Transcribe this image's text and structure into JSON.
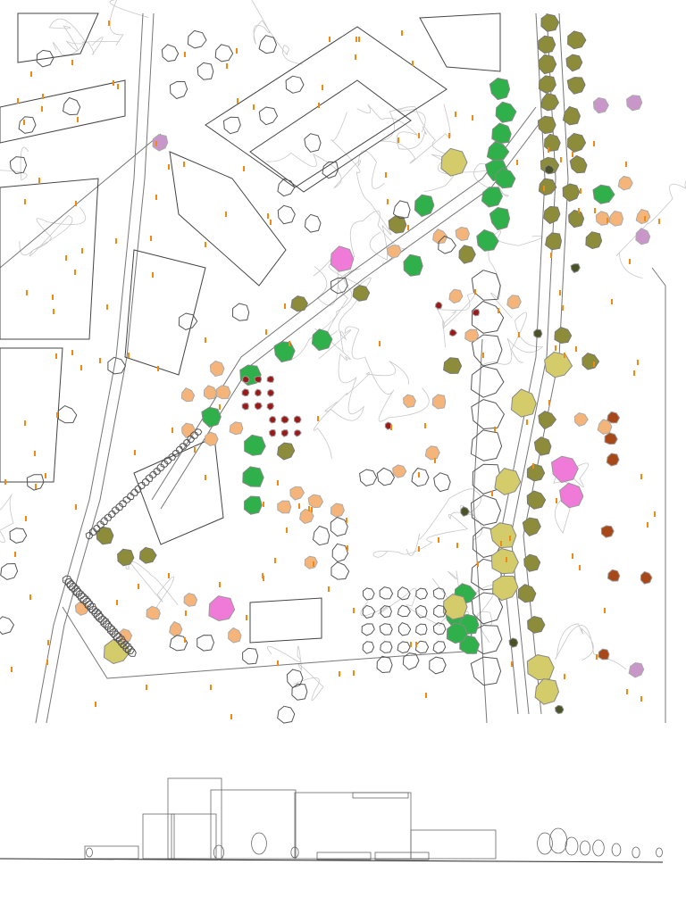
{
  "drawing": {
    "type": "landscape site plan with street elevation",
    "palette": {
      "outline": "#555555",
      "contour": "#bbbbbb",
      "deciduous_green": "#2fb04a",
      "olive": "#8c8c3a",
      "yellow_hatch": "#d4cc6a",
      "peach": "#f5b57a",
      "pink": "#f07ad8",
      "lilac": "#c896c8",
      "dark_red": "#9a1a1a",
      "rust": "#a84818",
      "dark_olive": "#4a5228",
      "label_orange": "#f08a10"
    }
  }
}
